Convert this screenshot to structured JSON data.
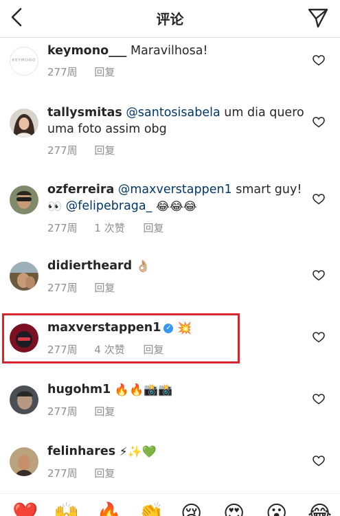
{
  "header": {
    "title": "评论"
  },
  "comments": [
    {
      "username": "keymono___",
      "text": "Maravilhosa!",
      "time": "277周",
      "reply": "回复",
      "avatar_text": "KEYMONO"
    },
    {
      "username": "tallysmitas",
      "mention": "@santosisabela",
      "text1": " um dia quero",
      "text2": "uma foto assim obg",
      "time": "277周",
      "reply": "回复"
    },
    {
      "username": "ozferreira",
      "mention": "@maxverstappen1",
      "text1": " smart guy!",
      "emoji_eyes": "👀",
      "mention2": "@felipebraga_",
      "emoji_laugh": "😂😂😂",
      "time": "277周",
      "likes": "1 次赞",
      "reply": "回复"
    },
    {
      "username": "didiertheard",
      "emoji": "👌🏼",
      "time": "277周",
      "reply": "回复"
    },
    {
      "username": "maxverstappen1",
      "emoji": "💥",
      "time": "277周",
      "likes": "4 次赞",
      "reply": "回复"
    },
    {
      "username": "hugohm1",
      "emoji": "🔥🔥📸📸",
      "time": "277周",
      "reply": "回复"
    },
    {
      "username": "felinhares",
      "emoji": "⚡✨💚",
      "time": "277周",
      "reply": "回复"
    }
  ],
  "emoji_bar": [
    "❤️",
    "🙌",
    "🔥",
    "👏",
    "😢",
    "😍",
    "😮",
    "😂"
  ],
  "colors": {
    "highlight": "#d9232d",
    "mention": "#00376b",
    "meta": "#8e8e8e",
    "verified": "#3897f0"
  }
}
